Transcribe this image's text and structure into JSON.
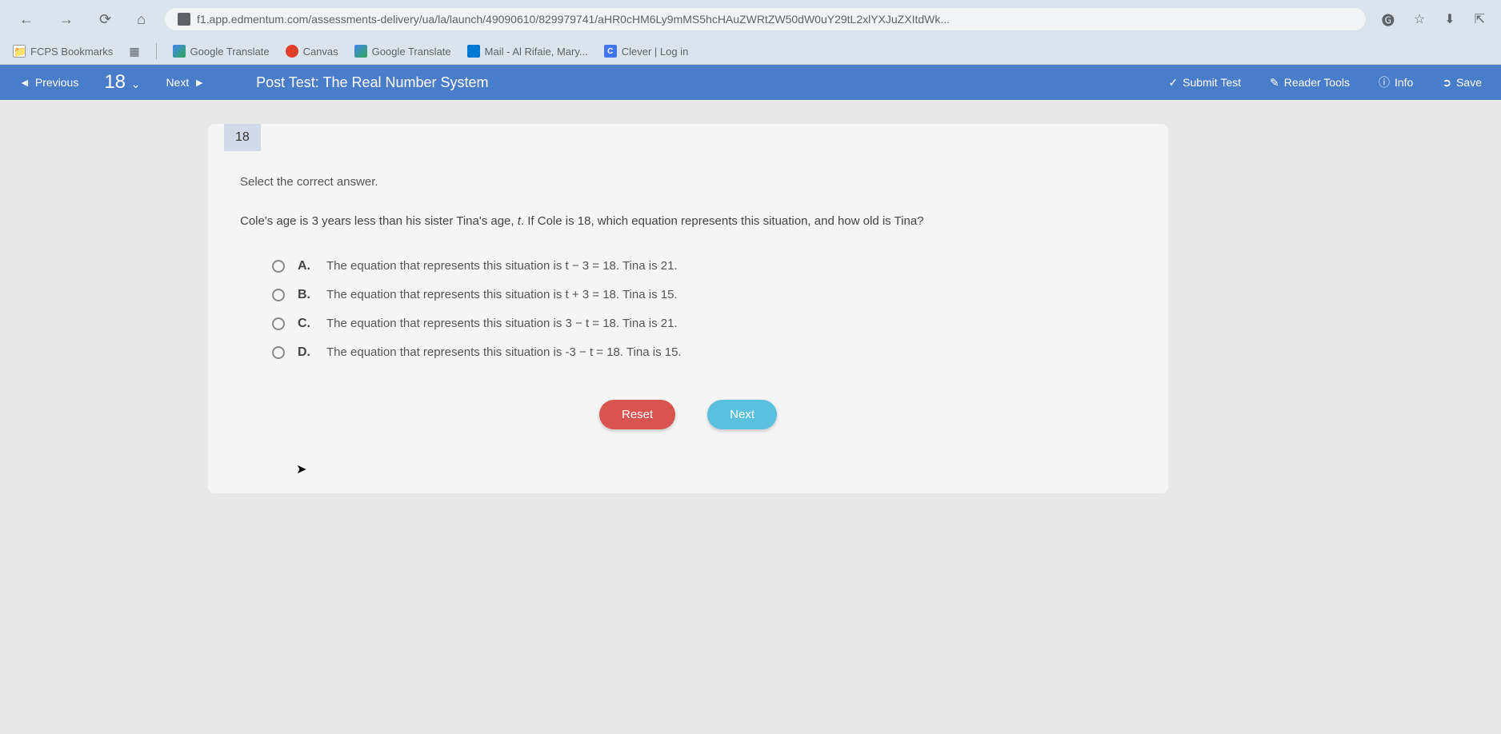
{
  "browser": {
    "url": "f1.app.edmentum.com/assessments-delivery/ua/la/launch/49090610/829979741/aHR0cHM6Ly9mMS5hcHAuZWRtZW50dW0uY29tL2xlYXJuZXItdWk...",
    "bookmarks": [
      {
        "label": "FCPS Bookmarks"
      },
      {
        "label": "Google Translate"
      },
      {
        "label": "Canvas"
      },
      {
        "label": "Google Translate"
      },
      {
        "label": "Mail - Al Rifaie, Mary..."
      },
      {
        "label": "Clever | Log in"
      }
    ]
  },
  "header": {
    "previous": "Previous",
    "questionNumber": "18",
    "next": "Next",
    "title": "Post Test: The Real Number System",
    "submit": "Submit Test",
    "readerTools": "Reader Tools",
    "info": "Info",
    "save": "Save"
  },
  "question": {
    "number": "18",
    "instruction": "Select the correct answer.",
    "text_part1": "Cole's age is 3 years less than his sister Tina's age, ",
    "text_var": "t",
    "text_part2": ". If Cole is 18, which equation represents this situation, and how old is Tina?",
    "answers": [
      {
        "letter": "A.",
        "text": "The equation that represents this situation is t − 3 = 18. Tina is 21."
      },
      {
        "letter": "B.",
        "text": "The equation that represents this situation is t + 3 = 18. Tina is 15."
      },
      {
        "letter": "C.",
        "text": "The equation that represents this situation is 3 − t = 18. Tina is 21."
      },
      {
        "letter": "D.",
        "text": "The equation that represents this situation is -3 − t = 18. Tina is 15."
      }
    ],
    "reset": "Reset",
    "nextBtn": "Next"
  }
}
